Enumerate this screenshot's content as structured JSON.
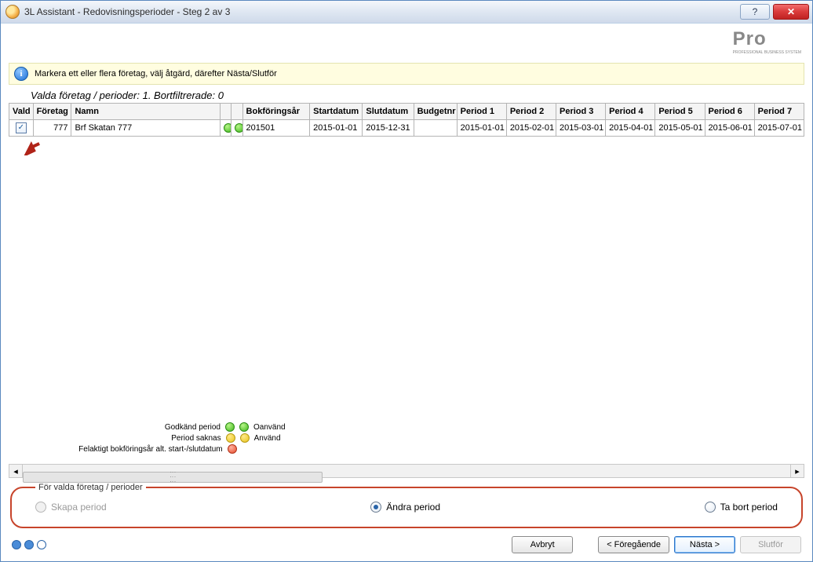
{
  "window": {
    "title": "3L Assistant - Redovisningsperioder - Steg 2 av 3"
  },
  "logo": {
    "main": "Pro",
    "sub": "PROFESSIONAL BUSINESS SYSTEM"
  },
  "info_bar": {
    "text": "Markera ett eller flera företag, välj åtgärd, därefter Nästa/Slutför"
  },
  "subtitle": "Valda företag / perioder: 1. Bortfiltrerade: 0",
  "table": {
    "headers": {
      "vald": "Vald",
      "foretag": "Företag",
      "namn": "Namn",
      "status1": "",
      "status2": "",
      "bokforingsar": "Bokföringsår",
      "startdatum": "Startdatum",
      "slutdatum": "Slutdatum",
      "budgetnr": "Budgetnr",
      "period1": "Period 1",
      "period2": "Period 2",
      "period3": "Period 3",
      "period4": "Period 4",
      "period5": "Period 5",
      "period6": "Period 6",
      "period7": "Period 7"
    },
    "rows": [
      {
        "vald_checked": true,
        "foretag": "777",
        "namn": "Brf Skatan 777",
        "status1": "green",
        "status2": "green",
        "bokforingsar": "201501",
        "startdatum": "2015-01-01",
        "slutdatum": "2015-12-31",
        "budgetnr": "",
        "period1": "2015-01-01",
        "period2": "2015-02-01",
        "period3": "2015-03-01",
        "period4": "2015-04-01",
        "period5": "2015-05-01",
        "period6": "2015-06-01",
        "period7": "2015-07-01"
      }
    ]
  },
  "legend": {
    "r1_left": "Godkänd period",
    "r1_right": "Oanvänd",
    "r2_left": "Period saknas",
    "r2_right": "Använd",
    "r3_left": "Felaktigt bokföringsår alt. start-/slutdatum"
  },
  "action_group": {
    "legend": "För valda företag / perioder",
    "options": {
      "create": "Skapa period",
      "modify": "Ändra period",
      "delete": "Ta bort period"
    },
    "selected": "modify",
    "create_disabled": true
  },
  "buttons": {
    "cancel": "Avbryt",
    "back": "< Föregående",
    "next": "Nästa >",
    "finish": "Slutför"
  },
  "glyphs": {
    "help": "?",
    "close": "✕",
    "info": "i",
    "tick": "✓",
    "tri_left": "◂",
    "tri_right": "▸"
  }
}
